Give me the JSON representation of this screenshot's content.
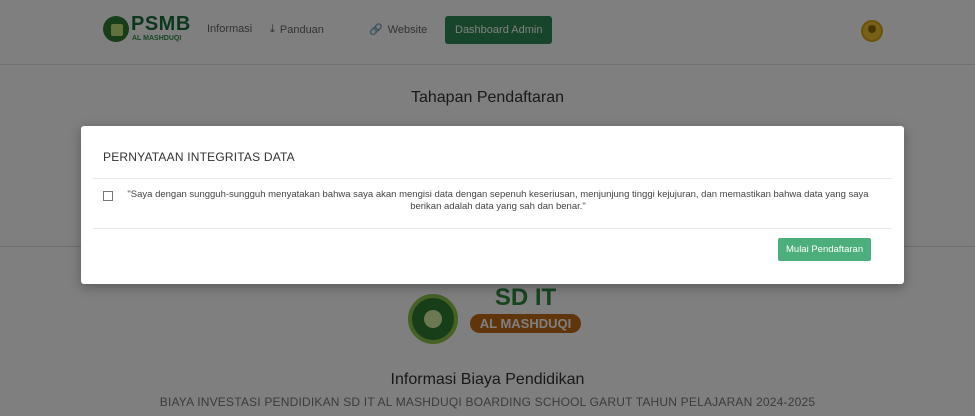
{
  "nav": {
    "logo_text": "PSMB",
    "logo_subtext": "AL MASHDUQI",
    "items": [
      {
        "label": "Informasi",
        "icon": ""
      },
      {
        "label": "Panduan",
        "icon": "download-icon"
      },
      {
        "label": "Website",
        "icon": "link-icon"
      }
    ],
    "admin_label": "Dashboard Admin"
  },
  "page": {
    "title": "Tahapan Pendaftaran",
    "school_name_line1": "SD IT",
    "school_name_line2": "AL MASHDUQI",
    "info_title": "Informasi Biaya Pendidikan",
    "info_subtitle": "BIAYA INVESTASI PENDIDIKAN SD IT AL MASHDUQI BOARDING SCHOOL GARUT TAHUN PELAJARAN 2024-2025"
  },
  "modal": {
    "title": "PERNYATAAN INTEGRITAS DATA",
    "statement": "\"Saya dengan sungguh-sungguh menyatakan bahwa saya akan mengisi data dengan sepenuh keseriusan, menjunjung tinggi kejujuran, dan memastikan bahwa data yang saya berikan adalah data yang sah dan benar.\"",
    "checkbox_checked": false,
    "button_label": "Mulai Pendaftaran"
  },
  "colors": {
    "brand_green": "#2e8b57",
    "button_green": "#4cae7a",
    "school_orange": "#c26b17"
  }
}
